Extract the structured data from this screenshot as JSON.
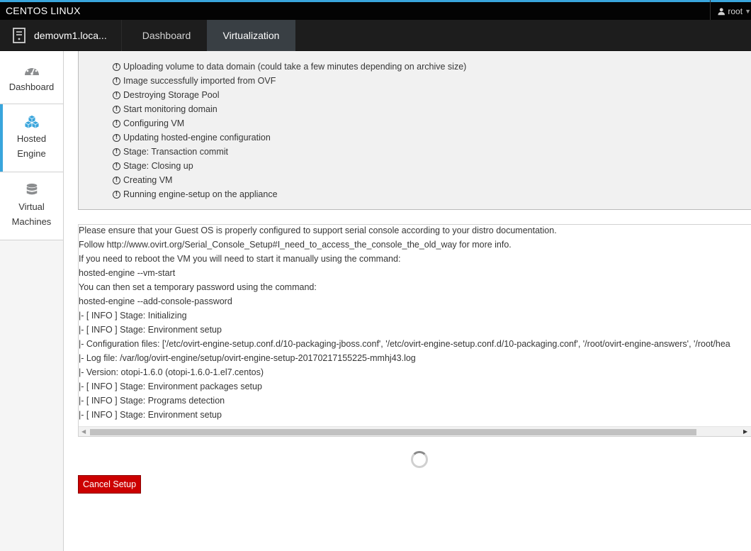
{
  "topbar": {
    "brand": "CENTOS LINUX",
    "user": "root"
  },
  "navbar": {
    "host": "demovm1.loca...",
    "tabs": [
      {
        "label": "Dashboard",
        "active": false
      },
      {
        "label": "Virtualization",
        "active": true
      }
    ]
  },
  "sidebar": {
    "items": [
      {
        "label": "Dashboard",
        "icon": "tachometer-icon",
        "active": false
      },
      {
        "label": "Hosted Engine",
        "icon": "cubes-icon",
        "active": true
      },
      {
        "label": "Virtual Machines",
        "icon": "database-icon",
        "active": false
      }
    ]
  },
  "status": {
    "messages": [
      "Uploading volume to data domain (could take a few minutes depending on archive size)",
      "Image successfully imported from OVF",
      "Destroying Storage Pool",
      "Start monitoring domain",
      "Configuring VM",
      "Updating hosted-engine configuration",
      "Stage: Transaction commit",
      "Stage: Closing up",
      "Creating VM",
      "Running engine-setup on the appliance"
    ]
  },
  "log": {
    "lines": [
      "Please ensure that your Guest OS is properly configured to support serial console according to your distro documentation.",
      "Follow http://www.ovirt.org/Serial_Console_Setup#I_need_to_access_the_console_the_old_way for more info.",
      "If you need to reboot the VM you will need to start it manually using the command:",
      "hosted-engine --vm-start",
      "You can then set a temporary password using the command:",
      "hosted-engine --add-console-password",
      "|- [ INFO ] Stage: Initializing",
      "|- [ INFO ] Stage: Environment setup",
      "|- Configuration files: ['/etc/ovirt-engine-setup.conf.d/10-packaging-jboss.conf', '/etc/ovirt-engine-setup.conf.d/10-packaging.conf', '/root/ovirt-engine-answers', '/root/hea",
      "|- Log file: /var/log/ovirt-engine/setup/ovirt-engine-setup-20170217155225-mmhj43.log",
      "|- Version: otopi-1.6.0 (otopi-1.6.0-1.el7.centos)",
      "|- [ INFO ] Stage: Environment packages setup",
      "|- [ INFO ] Stage: Programs detection",
      "|- [ INFO ] Stage: Environment setup"
    ]
  },
  "actions": {
    "cancel_label": "Cancel Setup"
  },
  "colors": {
    "accent": "#39a5dc",
    "danger": "#cc0000",
    "topbar": "#030303",
    "navbar": "#1d1d1d",
    "active_tab": "#393f44"
  }
}
